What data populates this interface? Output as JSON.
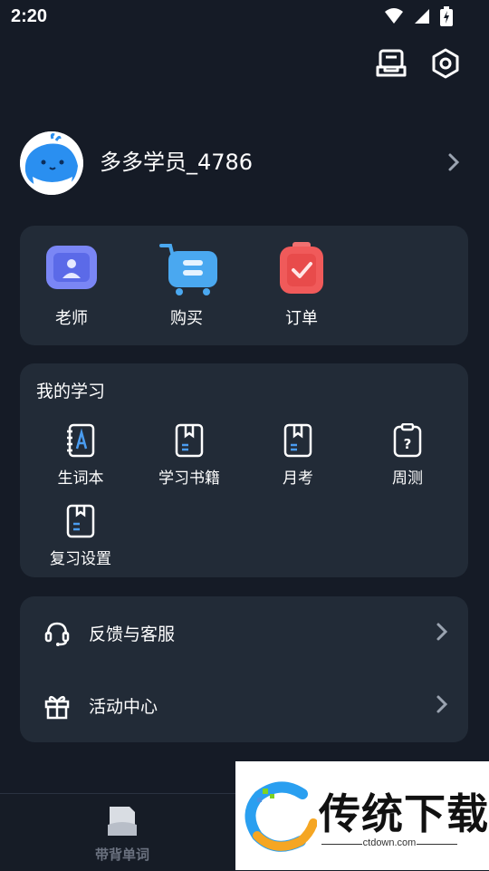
{
  "status_bar": {
    "time": "2:20",
    "icons": [
      "wifi-icon",
      "cellular-signal-icon",
      "battery-charging-icon"
    ]
  },
  "top_actions": {
    "icons": [
      "document-list-icon",
      "settings-hexagon-icon"
    ]
  },
  "profile": {
    "username": "多多学员_4786"
  },
  "shortcuts": [
    {
      "label": "老师",
      "icon": "teacher-icon",
      "color": "#6b7cf0"
    },
    {
      "label": "购买",
      "icon": "shopping-cart-icon",
      "color": "#4aa8f0"
    },
    {
      "label": "订单",
      "icon": "order-clipboard-icon",
      "color": "#f05a5a"
    }
  ],
  "learning": {
    "title": "我的学习",
    "items": [
      {
        "label": "生词本",
        "icon": "vocabulary-book-icon"
      },
      {
        "label": "学习书籍",
        "icon": "study-books-icon"
      },
      {
        "label": "月考",
        "icon": "monthly-exam-icon"
      },
      {
        "label": "周测",
        "icon": "weekly-test-icon"
      },
      {
        "label": "复习设置",
        "icon": "review-settings-icon"
      }
    ]
  },
  "menu": [
    {
      "label": "反馈与客服",
      "icon": "headset-icon"
    },
    {
      "label": "活动中心",
      "icon": "gift-icon"
    }
  ],
  "bottom_nav": {
    "items": [
      {
        "label": "带背单词",
        "icon": "flashcard-icon"
      }
    ]
  },
  "watermark": {
    "title": "传统下载",
    "subtitle": "ctdown.com"
  },
  "colors": {
    "background": "#151b26",
    "card": "#222b37",
    "accent": "#4a9cf0"
  }
}
